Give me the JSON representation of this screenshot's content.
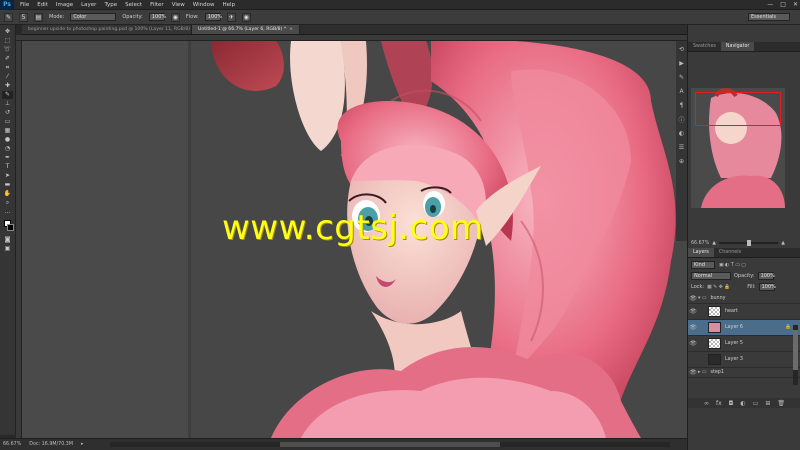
{
  "app": {
    "logo": "Ps"
  },
  "menu": [
    "File",
    "Edit",
    "Image",
    "Layer",
    "Type",
    "Select",
    "Filter",
    "View",
    "Window",
    "Help"
  ],
  "window_controls": [
    "—",
    "□",
    "✕"
  ],
  "options": {
    "mode_label": "Mode:",
    "mode_value": "Color",
    "opacity_label": "Opacity:",
    "opacity_value": "100%",
    "flow_label": "Flow:",
    "flow_value": "100%",
    "brush_size": "5",
    "workspace": "Essentials"
  },
  "tabs": [
    {
      "label": "beginner upside to photoshop painting.psd @ 100% (Layer 11, RGB/8)"
    },
    {
      "label": "Untitled-1 @ 66.7% (Layer 6, RGB/8) *"
    }
  ],
  "watermark": "www.cgtsj.com",
  "status": {
    "zoom": "66.67%",
    "doc": "Doc: 16.9M/70.3M"
  },
  "panels": {
    "nav_tabs": [
      "Swatches",
      "Navigator"
    ],
    "nav_zoom": "66.67%",
    "layer_tabs": [
      "Layers",
      "Channels"
    ],
    "filter_kind": "Kind",
    "blend_mode": "Normal",
    "opacity_label": "Opacity:",
    "opacity_value": "100%",
    "lock_label": "Lock:",
    "fill_label": "Fill:",
    "fill_value": "100%"
  },
  "layers": [
    {
      "name": "bunny",
      "type": "group"
    },
    {
      "name": "heart",
      "type": "layer"
    },
    {
      "name": "Layer 6",
      "type": "layer",
      "selected": true
    },
    {
      "name": "Layer 5",
      "type": "layer"
    },
    {
      "name": "Layer 3",
      "type": "layer"
    },
    {
      "name": "step1",
      "type": "group"
    }
  ],
  "icons": {
    "tools": [
      "move",
      "marquee",
      "lasso",
      "quick-select",
      "crop",
      "eyedropper",
      "healing",
      "brush",
      "clone-stamp",
      "history-brush",
      "eraser",
      "gradient",
      "blur",
      "dodge",
      "pen",
      "type",
      "path-select",
      "shape",
      "hand",
      "zoom"
    ],
    "layer_footer": [
      "link",
      "fx",
      "mask",
      "adjustment",
      "folder",
      "new-layer",
      "trash"
    ]
  },
  "colors": {
    "accent": "#4a6d8c",
    "watermark": "#ffff1a",
    "skin": "#f2c9c0",
    "hair": "#e86a82"
  }
}
